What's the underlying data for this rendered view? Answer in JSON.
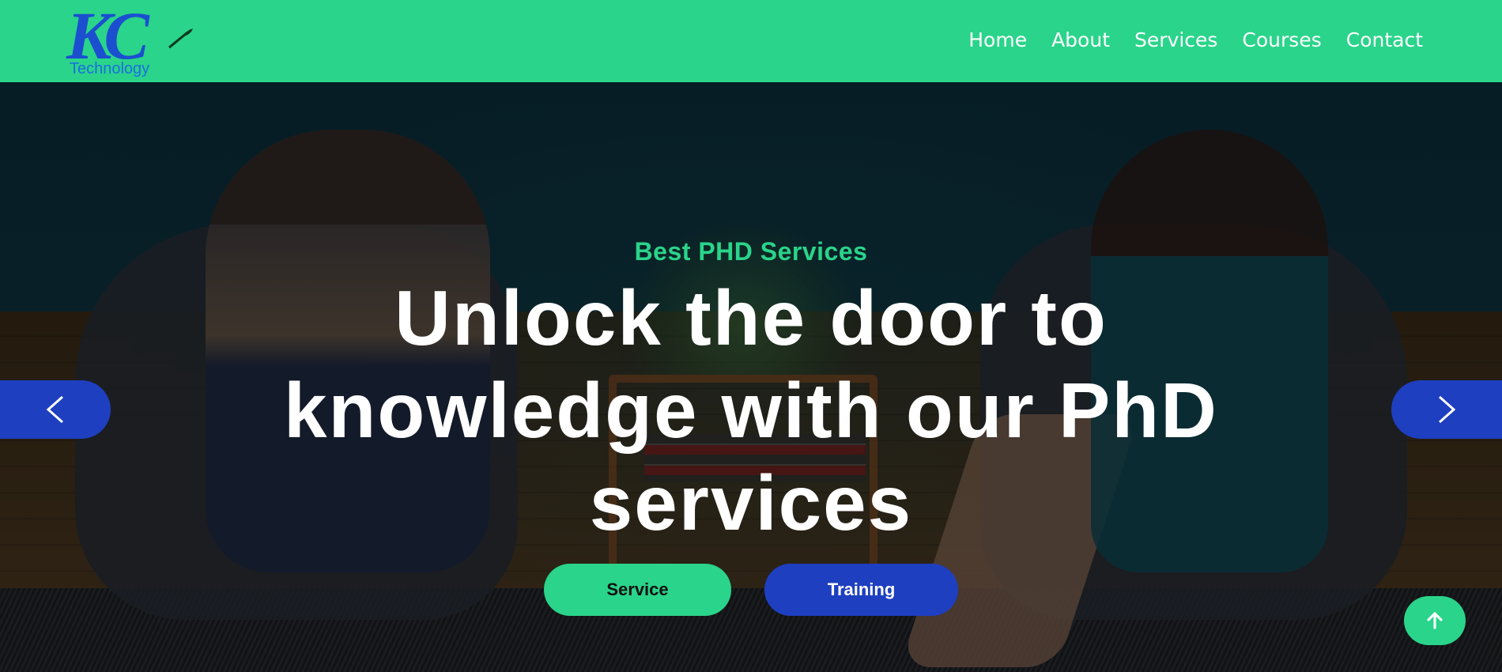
{
  "brand": {
    "logo_mark": "KC",
    "logo_text": "Technology",
    "primary_color": "#2ad48a",
    "accent_color": "#1e3fc0"
  },
  "nav": {
    "items": [
      {
        "label": "Home"
      },
      {
        "label": "About"
      },
      {
        "label": "Services"
      },
      {
        "label": "Courses"
      },
      {
        "label": "Contact"
      }
    ]
  },
  "hero": {
    "subtitle": "Best PHD Services",
    "headline": "Unlock the door to knowledge with our PhD services",
    "buttons": {
      "service_label": "Service",
      "training_label": "Training"
    },
    "carousel": {
      "prev_icon": "chevron-left-icon",
      "next_icon": "chevron-right-icon"
    }
  },
  "scroll_top": {
    "icon": "arrow-up-icon"
  }
}
